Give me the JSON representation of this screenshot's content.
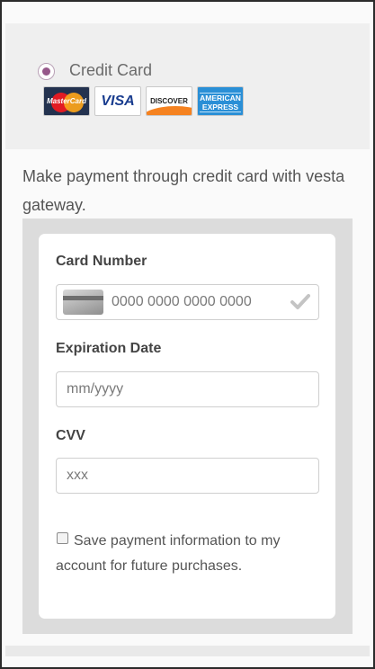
{
  "payment_method": {
    "label": "Credit Card",
    "selected": true,
    "card_logos": [
      {
        "name": "mastercard",
        "text": "MasterCard"
      },
      {
        "name": "visa",
        "text": "VISA"
      },
      {
        "name": "discover",
        "text": "DISCOVER"
      },
      {
        "name": "amex",
        "text_line1": "AMERICAN",
        "text_line2": "EXPRESS"
      }
    ]
  },
  "description": "Make payment through credit card with vesta gateway.",
  "form": {
    "card_number": {
      "label": "Card Number",
      "placeholder": "0000 0000 0000 0000",
      "icon": "credit-card-icon",
      "status_icon": "checkmark-icon"
    },
    "expiration": {
      "label": "Expiration Date",
      "placeholder": "mm/yyyy"
    },
    "cvv": {
      "label": "CVV",
      "placeholder": "xxx"
    },
    "save": {
      "label": "Save payment information to my account for future purchases.",
      "checked": false
    }
  },
  "colors": {
    "radio_accent": "#96588a",
    "panel_bg": "#efefef",
    "form_wrap_bg": "#dcdcdc"
  }
}
